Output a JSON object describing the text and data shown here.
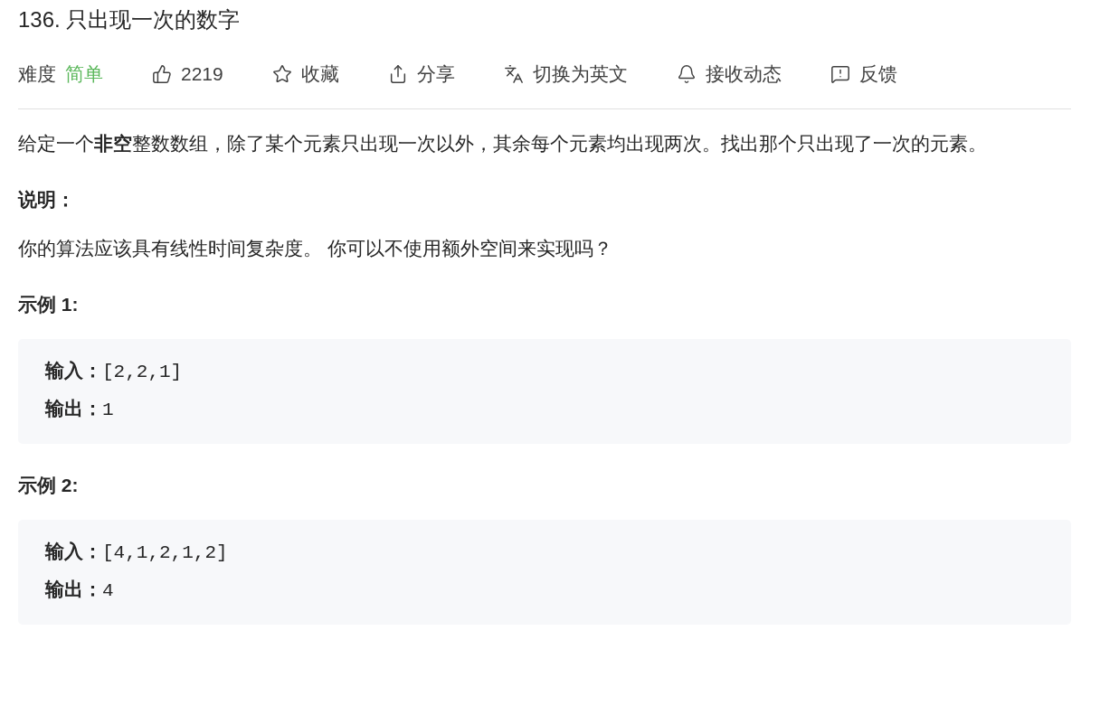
{
  "title": "136. 只出现一次的数字",
  "toolbar": [
    {
      "kind": "difficulty",
      "label": "难度",
      "value": "简单"
    },
    {
      "kind": "like",
      "label": "2219"
    },
    {
      "kind": "star",
      "label": "收藏"
    },
    {
      "kind": "share",
      "label": "分享"
    },
    {
      "kind": "translate",
      "label": "切换为英文"
    },
    {
      "kind": "bell",
      "label": "接收动态"
    },
    {
      "kind": "feedback",
      "label": "反馈"
    }
  ],
  "content": [
    {
      "kind": "paragraph",
      "text": "给定一个**非空**整数数组，除了某个元素只出现一次以外，其余每个元素均出现两次。找出那个只出现了一次的元素。"
    },
    {
      "kind": "heading",
      "text": "说明："
    },
    {
      "kind": "paragraph",
      "text": "你的算法应该具有线性时间复杂度。 你可以不使用额外空间来实现吗？"
    },
    {
      "kind": "heading",
      "text": "示例 1:"
    },
    {
      "kind": "example",
      "lines": [
        {
          "label": "输入：",
          "value": "[2,2,1]"
        },
        {
          "label": "输出：",
          "value": "1"
        }
      ]
    },
    {
      "kind": "heading",
      "text": "示例 2:"
    },
    {
      "kind": "example",
      "lines": [
        {
          "label": "输入：",
          "value": "[4,1,2,1,2]"
        },
        {
          "label": "输出：",
          "value": "4"
        }
      ]
    }
  ]
}
